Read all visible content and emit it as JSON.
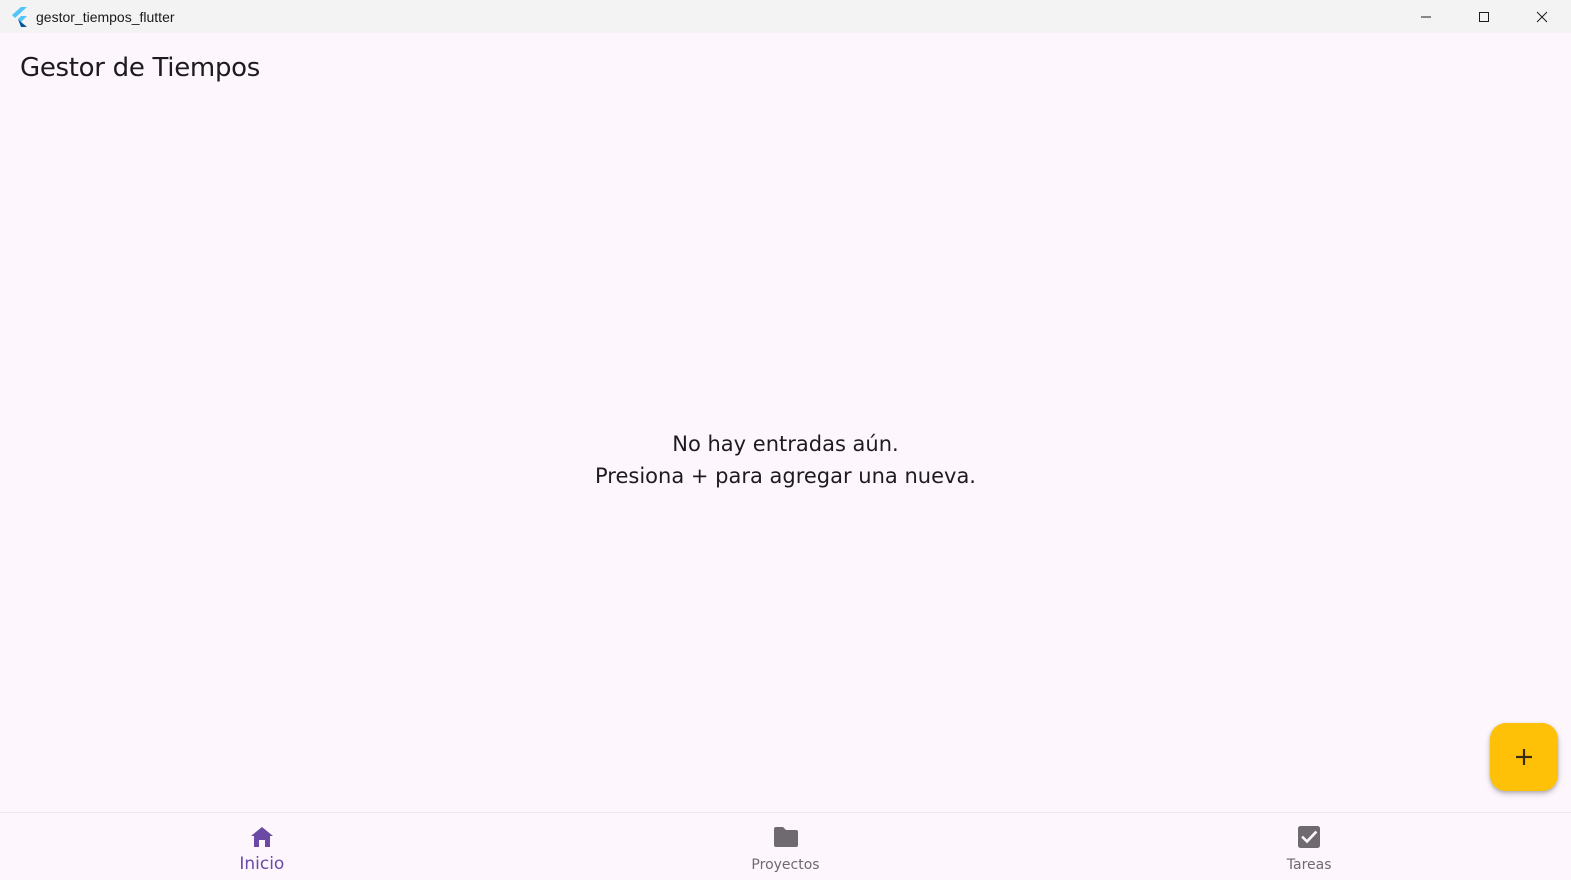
{
  "window": {
    "title": "gestor_tiempos_flutter"
  },
  "appbar": {
    "title": "Gestor de Tiempos"
  },
  "empty_state": {
    "line1": "No hay entradas aún.",
    "line2": "Presiona + para agregar una nueva."
  },
  "fab": {
    "icon": "add-icon",
    "color": "#ffc107"
  },
  "bottom_nav": {
    "active_color": "#6a4aa5",
    "inactive_color": "#6f6a70",
    "items": [
      {
        "label": "Inicio",
        "icon": "home-icon",
        "active": true
      },
      {
        "label": "Proyectos",
        "icon": "folder-icon",
        "active": false
      },
      {
        "label": "Tareas",
        "icon": "checkbox-icon",
        "active": false
      }
    ]
  }
}
